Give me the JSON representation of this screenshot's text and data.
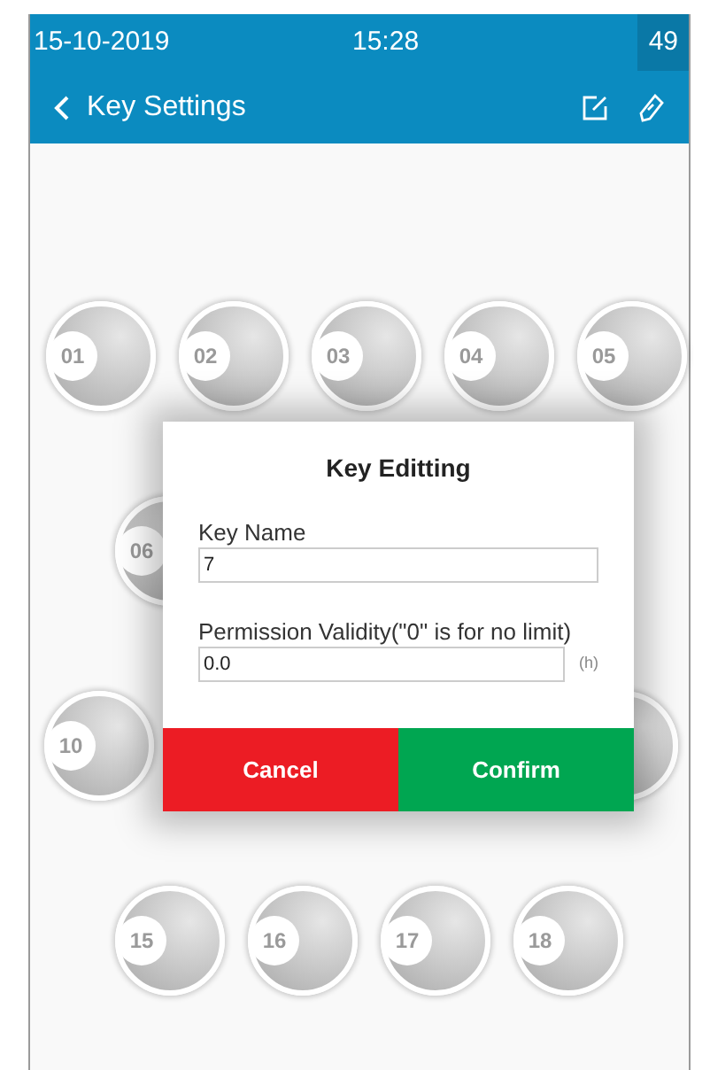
{
  "status_bar": {
    "date": "15-10-2019",
    "time": "15:28",
    "battery": "49"
  },
  "app_bar": {
    "title": "Key Settings"
  },
  "key_rows": [
    {
      "keys": [
        {
          "kind": "numbered",
          "label": "01"
        },
        {
          "kind": "numbered",
          "label": "02"
        },
        {
          "kind": "numbered",
          "label": "03"
        },
        {
          "kind": "numbered",
          "label": "04"
        },
        {
          "kind": "numbered",
          "label": "05"
        }
      ]
    },
    {
      "keys": [
        {
          "kind": "numbered",
          "label": "06"
        }
      ]
    },
    {
      "keys": [
        {
          "kind": "numbered",
          "label": "10"
        },
        {
          "kind": "unlabeled"
        }
      ]
    },
    {
      "keys": [
        {
          "kind": "numbered",
          "label": "15"
        },
        {
          "kind": "numbered",
          "label": "16"
        },
        {
          "kind": "numbered",
          "label": "17"
        },
        {
          "kind": "numbered",
          "label": "18"
        }
      ]
    }
  ],
  "dialog": {
    "title": "Key Editting",
    "fields": [
      {
        "label": "Key Name",
        "value": "7"
      },
      {
        "label": "Permission Validity(\"0\" is for no limit)",
        "value": "0.0",
        "unit": "(h)"
      }
    ],
    "buttons": [
      {
        "label": "Cancel",
        "kind": "cancel"
      },
      {
        "label": "Confirm",
        "kind": "confirm"
      }
    ]
  }
}
